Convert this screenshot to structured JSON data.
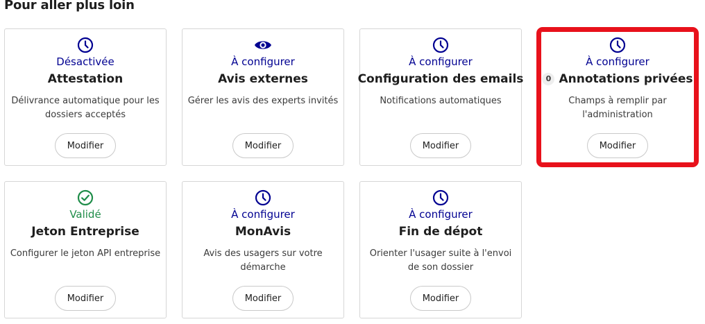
{
  "section": {
    "title": "Pour aller plus loin"
  },
  "colors": {
    "status_blue": "#000091",
    "status_green": "#1f8d49",
    "highlight_red": "#e8111b"
  },
  "cards": [
    {
      "icon": "clock-icon",
      "status": "Désactivée",
      "title": "Attestation",
      "description": "Délivrance automatique pour les dossiers acceptés",
      "button": "Modifier"
    },
    {
      "icon": "eye-icon",
      "status": "À configurer",
      "title": "Avis externes",
      "description": "Gérer les avis des experts invités",
      "button": "Modifier"
    },
    {
      "icon": "clock-icon",
      "status": "À configurer",
      "title": "Configuration des emails",
      "description": "Notifications automatiques",
      "button": "Modifier"
    },
    {
      "icon": "clock-icon",
      "status": "À configurer",
      "badge": "0",
      "title": "Annotations privées",
      "description": "Champs à remplir par l'administration",
      "button": "Modifier"
    },
    {
      "icon": "check-circle-icon",
      "status": "Validé",
      "title": "Jeton Entreprise",
      "description": "Configurer le jeton API entreprise",
      "button": "Modifier"
    },
    {
      "icon": "clock-icon",
      "status": "À configurer",
      "title": "MonAvis",
      "description": "Avis des usagers sur votre démarche",
      "button": "Modifier"
    },
    {
      "icon": "clock-icon",
      "status": "À configurer",
      "title": "Fin de dépot",
      "description": "Orienter l'usager suite à l'envoi de son dossier",
      "button": "Modifier"
    }
  ]
}
